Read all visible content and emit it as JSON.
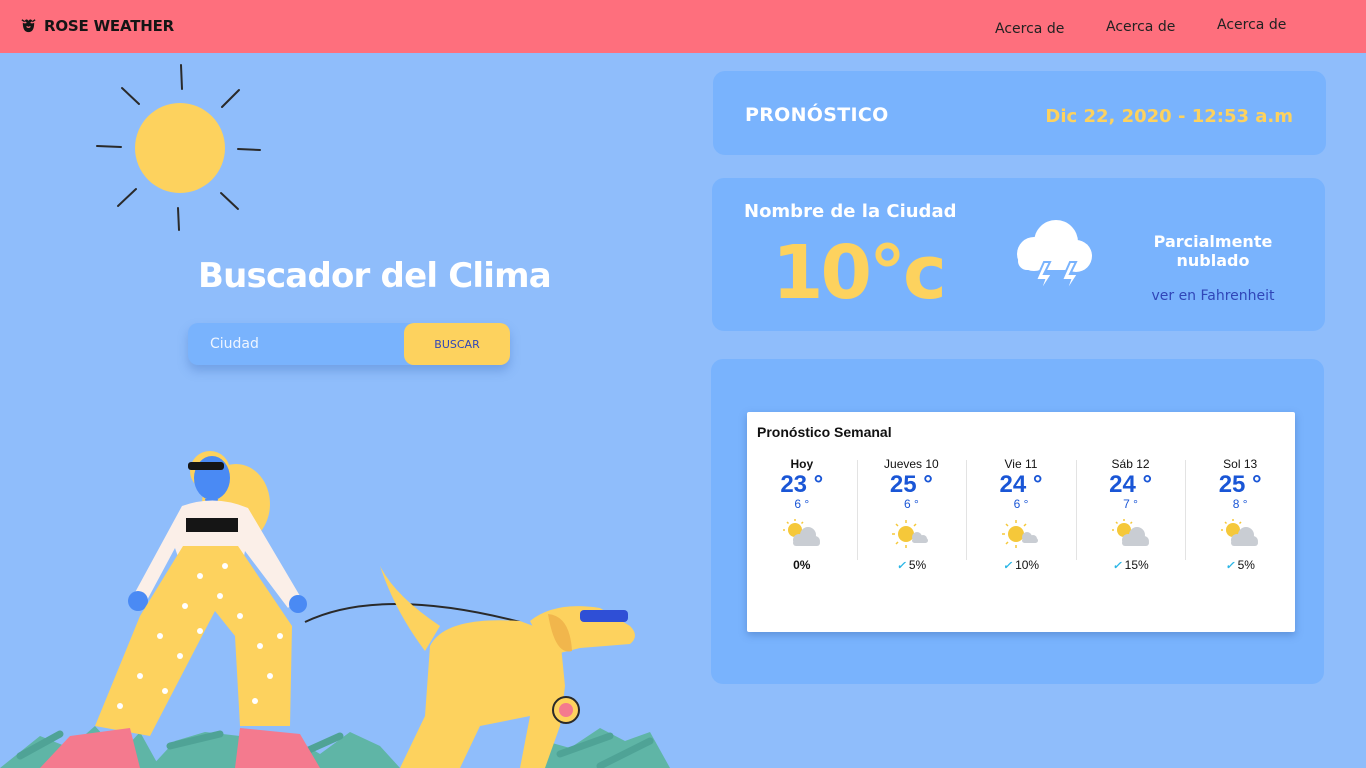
{
  "header": {
    "brand": "ROSE WEATHER",
    "nav": [
      "Acerca de",
      "Acerca de",
      "Acerca de"
    ]
  },
  "hero": {
    "title": "Buscador del Clima",
    "search_placeholder": "Ciudad",
    "search_button": "BUSCAR"
  },
  "forecast_header": {
    "title": "PRONÓSTICO",
    "date": "Dic 22, 2020 - 12:53 a.m"
  },
  "current": {
    "city": "Nombre de la Ciudad",
    "temperature": "10°c",
    "condition": "Parcialmente nublado",
    "fahrenheit_link": "ver en Fahrenheit"
  },
  "weekly": {
    "title": "Pronóstico Semanal",
    "days": [
      {
        "name": "Hoy",
        "high": "23 °",
        "low": "6 °",
        "rain": "0%",
        "icon": "cloud-sun-icon"
      },
      {
        "name": "Jueves 10",
        "high": "25 °",
        "low": "6 °",
        "rain": "5%",
        "icon": "sun-cloud-icon"
      },
      {
        "name": "Vie 11",
        "high": "24 °",
        "low": "6 °",
        "rain": "10%",
        "icon": "sun-cloud-icon"
      },
      {
        "name": "Sáb 12",
        "high": "24 °",
        "low": "7 °",
        "rain": "15%",
        "icon": "cloud-sun-icon"
      },
      {
        "name": "Sol 13",
        "high": "25 °",
        "low": "8 °",
        "rain": "5%",
        "icon": "cloud-sun-icon"
      }
    ]
  },
  "colors": {
    "background": "#8fbdfb",
    "header": "#fe6f7d",
    "card": "#79b3fd",
    "accent_yellow": "#fdd25e",
    "link_blue": "#3046b8",
    "widget_blue": "#1a56d6"
  }
}
